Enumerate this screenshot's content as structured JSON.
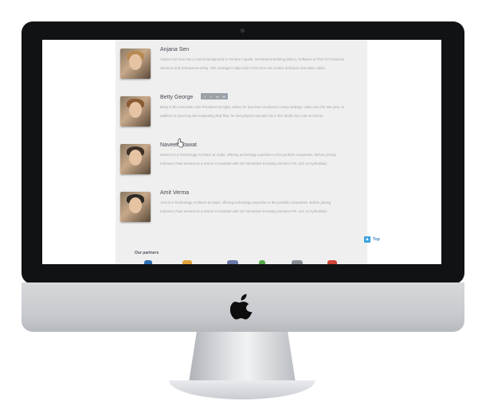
{
  "members": [
    {
      "name": "Anjana Sen",
      "bio": "Anjana Sen has has a varied background in Venture Capital, Investment Banking (M&A), Software & ITES for Financial Services and Entrepreneurship. She manages Indjet and in free time she makes delicious chocolate cakes.",
      "hair_color": "#b88a52"
    },
    {
      "name": "Betty George",
      "bio": "Betty is the Associate Vice President at Indjet, where he has been involved in many strategic roles over the last year. In addition to sourcing and evaluating deal flow, he has played a pivotal role in the Studio key role as interim.",
      "hair_color": "#8a5a32"
    },
    {
      "name": "Naveen Rawat",
      "bio": "Naveen is a Technology Architect at Indjet, offering technology expertise to the portfolio companies. Before joining Indonest, Ram worked as a Senior Consultant with GS Interactive Knowing Services Pvt. Ltd. at Hyderabad.",
      "hair_color": "#3e3228"
    },
    {
      "name": "Amit Verma",
      "bio": "Amit is a Technology Architect at Indjet, offering technology expertise to the portfolio companies. Before joining Indonest, Ram worked as a Senior Consultant with GS Interactive Knowing Services Pvt. Ltd. at Hyderabad.",
      "hair_color": "#2f2a26"
    }
  ],
  "social_icons": [
    "f",
    "t",
    "in",
    "✉"
  ],
  "top_link": {
    "label": "Top",
    "icon": "arrow-up-icon"
  },
  "partners": {
    "title": "Our partners",
    "colors": [
      "#2d6fb4",
      "#e0a23a",
      "#6a78a8",
      "#58a848",
      "#8a8f95",
      "#d0463a"
    ]
  },
  "colors": {
    "accent": "#3aa3de",
    "bezel": "#111214",
    "page_bg": "#efefef"
  }
}
